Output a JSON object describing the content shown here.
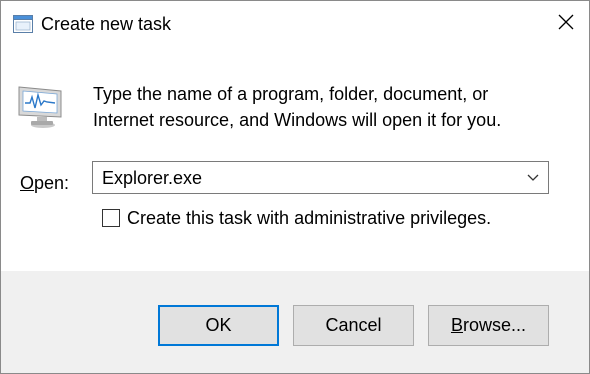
{
  "window": {
    "title": "Create new task",
    "close_icon": "close-icon",
    "app_icon": "run-dialog-icon"
  },
  "body": {
    "description_line1": "Type the name of a program, folder, document, or",
    "description_line2": "Internet resource, and Windows will open it for you.",
    "open_label": "Open:",
    "open_label_access_key": "O",
    "open_value": "Explorer.exe",
    "checkbox_label": "Create this task with administrative privileges.",
    "checkbox_checked": false
  },
  "buttons": {
    "ok": "OK",
    "cancel": "Cancel",
    "browse": "Browse..."
  },
  "colors": {
    "focus_border": "#0078d7",
    "footer_bg": "#f0f0f0",
    "button_bg": "#e1e1e1"
  }
}
